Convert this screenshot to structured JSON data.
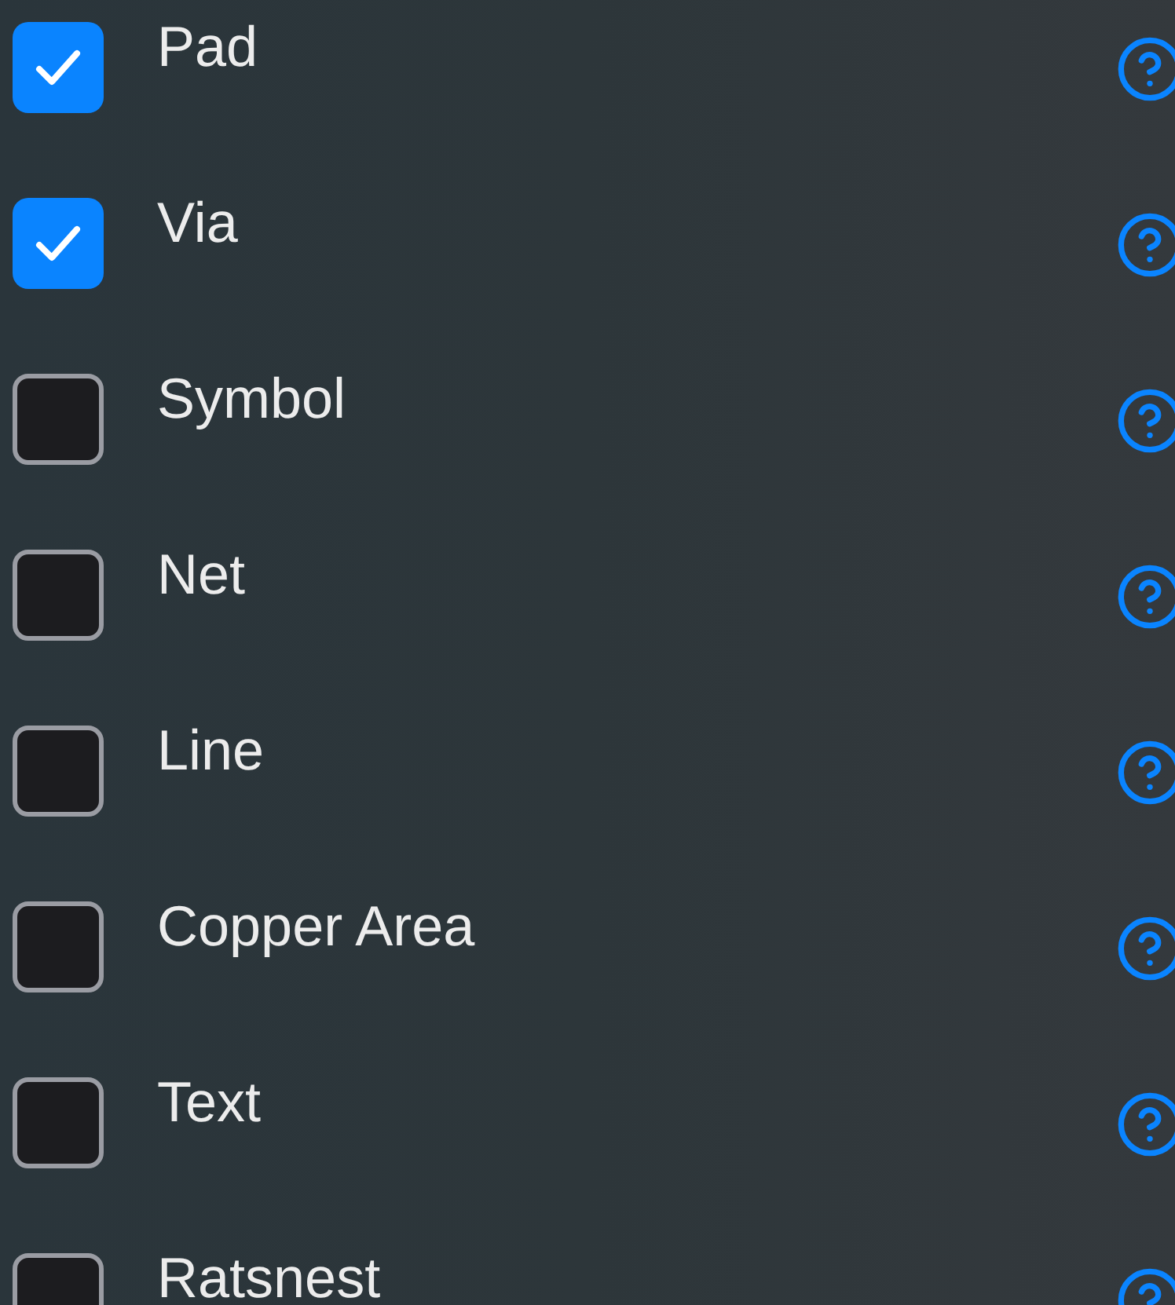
{
  "options": [
    {
      "label": "Pad",
      "checked": true
    },
    {
      "label": "Via",
      "checked": true
    },
    {
      "label": "Symbol",
      "checked": false
    },
    {
      "label": "Net",
      "checked": false
    },
    {
      "label": "Line",
      "checked": false
    },
    {
      "label": "Copper Area",
      "checked": false
    },
    {
      "label": "Text",
      "checked": false
    },
    {
      "label": "Ratsnest",
      "checked": false
    }
  ]
}
